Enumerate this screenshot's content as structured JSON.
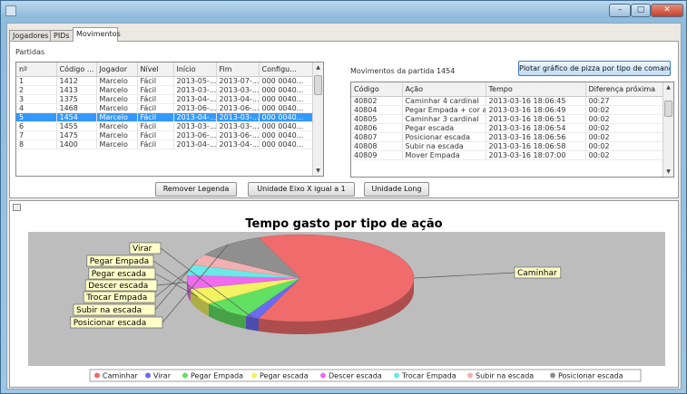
{
  "window": {
    "title": "",
    "min_glyph": "–",
    "max_glyph": "□",
    "close_glyph": "✕"
  },
  "tabs": [
    {
      "label": "Jogadores"
    },
    {
      "label": "PIDs"
    },
    {
      "label": "Movimentos"
    }
  ],
  "partidas": {
    "group_label": "Partidas",
    "columns": [
      "nº",
      "Código ...",
      "Jogador",
      "Nível",
      "Início",
      "Fim",
      "Configu..."
    ],
    "rows": [
      [
        "1",
        "1412",
        "Marcelo",
        "Fácil",
        "2013-05-...",
        "2013-07-...",
        "000 0040..."
      ],
      [
        "2",
        "1413",
        "Marcelo",
        "Fácil",
        "2013-03-...",
        "2013-03-...",
        "000 0040..."
      ],
      [
        "3",
        "1375",
        "Marcelo",
        "Fácil",
        "2013-04-...",
        "2013-04-...",
        "000 0040..."
      ],
      [
        "4",
        "1468",
        "Marcelo",
        "Fácil",
        "2013-06-...",
        "2013-06-...",
        "000 0040..."
      ],
      [
        "5",
        "1454",
        "Marcelo",
        "Fácil",
        "2013-04-...",
        "2013-03-...",
        "000 0040..."
      ],
      [
        "6",
        "1455",
        "Marcelo",
        "Fácil",
        "2013-03-...",
        "2013-03-...",
        "000 0040..."
      ],
      [
        "7",
        "1475",
        "Marcelo",
        "Fácil",
        "2013-06-...",
        "2013-06-...",
        "000 0040..."
      ],
      [
        "8",
        "1400",
        "Marcelo",
        "Fácil",
        "2013-04-...",
        "2013-04-...",
        "000 0040..."
      ]
    ],
    "selected_index": 4
  },
  "movimentos": {
    "group_label": "Movimentos da partida 1454",
    "chart_button": "Plotar gráfico de pizza por tipo de comando",
    "columns": [
      "Código",
      "Ação",
      "Tempo",
      "Diferença próxima"
    ],
    "rows": [
      [
        "40802",
        "Caminhar 4 cardinal",
        "2013-03-16 18:06:45",
        "00:27"
      ],
      [
        "40804",
        "Pegar Empada + cor a",
        "2013-03-16 18:06:49",
        "00:02"
      ],
      [
        "40805",
        "Caminhar 3 cardinal",
        "2013-03-16 18:06:51",
        "00:02"
      ],
      [
        "40806",
        "Pegar escada",
        "2013-03-16 18:06:54",
        "00:02"
      ],
      [
        "40807",
        "Posicionar escada",
        "2013-03-16 18:06:56",
        "00:02"
      ],
      [
        "40808",
        "Subir na escada",
        "2013-03-16 18:06:58",
        "00:02"
      ],
      [
        "40809",
        "Mover Empada",
        "2013-03-16 18:07:00",
        "00:02"
      ]
    ]
  },
  "actions": {
    "remove_legend": "Remover Legenda",
    "unit_unlabeled": "Unidade Eixo X igual a 1",
    "unit_long": "Unidade Long"
  },
  "chart_data": {
    "type": "pie",
    "title": "Tempo gasto por tipo de ação",
    "categories": [
      "Caminhar",
      "Virar",
      "Pegar Empada",
      "Pegar escada",
      "Descer escada",
      "Trocar Empada",
      "Subir na escada",
      "Posicionar escada"
    ],
    "values": [
      62,
      2,
      7,
      6,
      5,
      4,
      4,
      10
    ],
    "colors": [
      "#f06b6b",
      "#6b6bf0",
      "#62e062",
      "#f2f262",
      "#f06bf0",
      "#6be8e8",
      "#f2b0b0",
      "#8f8f8f"
    ],
    "callout_labels": [
      "Virar",
      "Pegar Empada",
      "Pegar escada",
      "Descer escada",
      "Trocar Empada",
      "Subir na escada",
      "Posicionar escada"
    ],
    "big_label": "Caminhar",
    "legend": "bottom",
    "style": "3d"
  }
}
